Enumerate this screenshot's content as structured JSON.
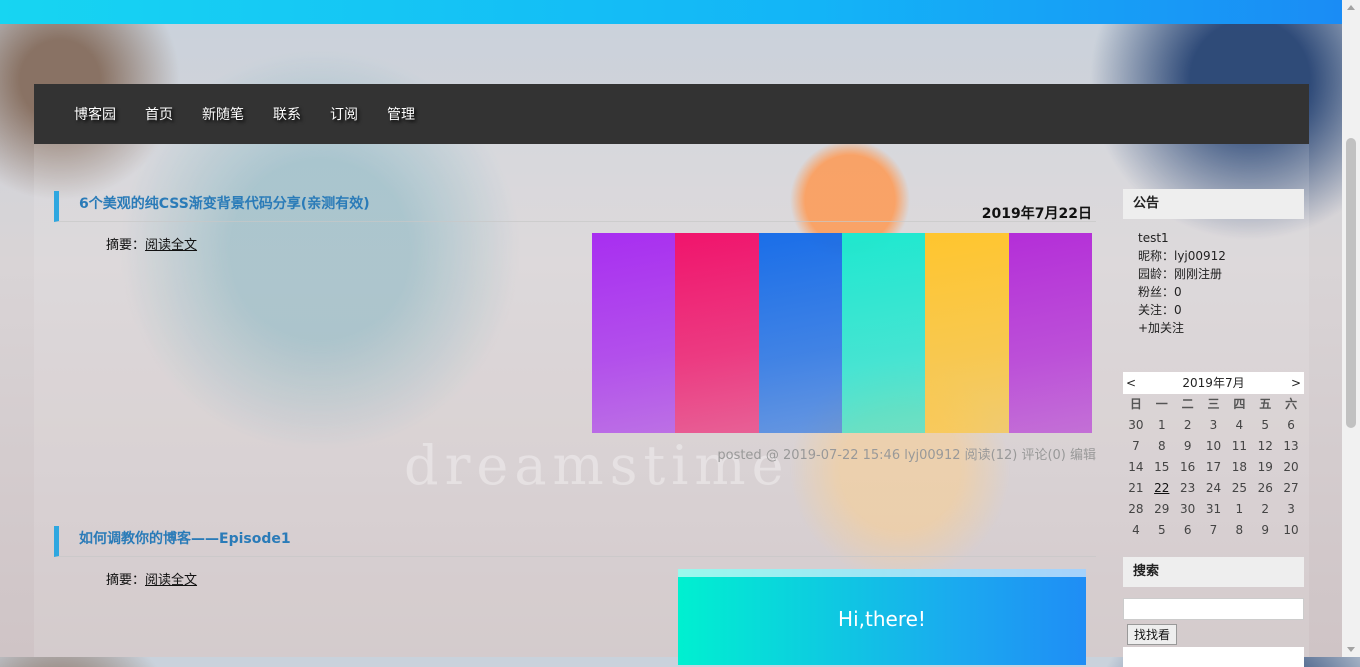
{
  "nav": {
    "items": [
      "博客园",
      "首页",
      "新随笔",
      "联系",
      "订阅",
      "管理"
    ]
  },
  "posts": [
    {
      "title": "6个美观的纯CSS渐变背景代码分享(亲测有效)",
      "date": "2019年7月22日",
      "summary_label": "摘要：",
      "read_more": "阅读全文",
      "posted": "posted @ 2019-07-22 15:46 lyj00912 阅读(12) 评论(0) 编辑",
      "stripe_colors": [
        "#a82ef0",
        "#f0146c",
        "#1a6ee8",
        "#1ee8d0",
        "#ffc52e",
        "#b42ed8"
      ]
    },
    {
      "title": "如何调教你的博客——Episode1",
      "summary_label": "摘要：",
      "read_more": "阅读全文",
      "image_text": "Hi,there!"
    }
  ],
  "watermark": "dreamstime",
  "sidebar": {
    "notice": {
      "title": "公告",
      "lines": [
        "test1",
        "昵称：lyj00912",
        "园龄：刚刚注册",
        "粉丝：0",
        "关注：0",
        "+加关注"
      ]
    },
    "calendar": {
      "prev": "<",
      "title": "2019年7月",
      "next": ">",
      "weekdays": [
        "日",
        "一",
        "二",
        "三",
        "四",
        "五",
        "六"
      ],
      "days": [
        "30",
        "1",
        "2",
        "3",
        "4",
        "5",
        "6",
        "7",
        "8",
        "9",
        "10",
        "11",
        "12",
        "13",
        "14",
        "15",
        "16",
        "17",
        "18",
        "19",
        "20",
        "21",
        "22",
        "23",
        "24",
        "25",
        "26",
        "27",
        "28",
        "29",
        "30",
        "31",
        "1",
        "2",
        "3",
        "4",
        "5",
        "6",
        "7",
        "8",
        "9",
        "10"
      ],
      "today": "22"
    },
    "search": {
      "title": "搜索",
      "button": "找找看",
      "value": ""
    }
  }
}
